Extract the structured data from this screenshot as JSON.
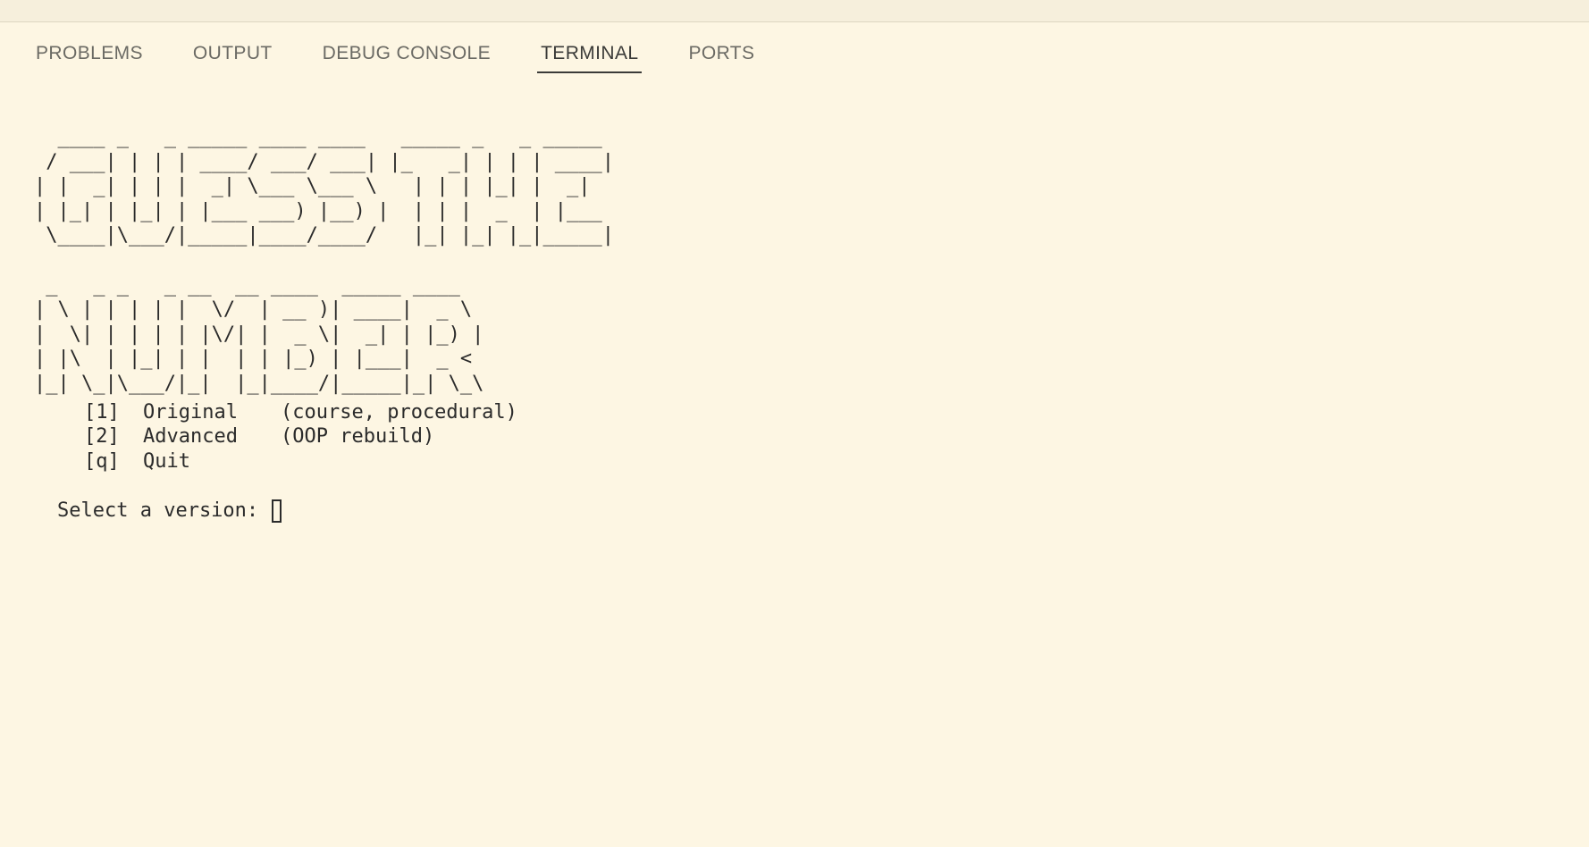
{
  "panel": {
    "tabs": [
      {
        "label": "PROBLEMS",
        "active": false
      },
      {
        "label": "OUTPUT",
        "active": false
      },
      {
        "label": "DEBUG CONSOLE",
        "active": false
      },
      {
        "label": "TERMINAL",
        "active": true
      },
      {
        "label": "PORTS",
        "active": false
      }
    ]
  },
  "terminal": {
    "banner": [
      "  ____ _   _ _____ ____ ____   _____ _   _ _____",
      " / ___| | | | ____/ ___/ ___| |_   _| | | | ____|",
      "| |  _| | | |  _| \\___ \\___ \\   | | | |_| |  _|",
      "| |_| | |_| | |___ ___) |__) |  | | |  _  | |___",
      " \\____|\\___/|_____|____/____/   |_| |_| |_|_____|",
      "",
      " _   _ _   _ __  __ ____  _____ ____",
      "| \\ | | | | |  \\/  | __ )| ____|  _ \\",
      "|  \\| | | | | |\\/| |  _ \\|  _| | |_) |",
      "| |\\  | |_| | |  | | |_) | |___|  _ <",
      "|_| \\_|\\___/|_|  |_|____/|_____|_| \\_\\"
    ],
    "menu": [
      {
        "key": "[1]",
        "name": "Original",
        "desc": "(course, procedural)"
      },
      {
        "key": "[2]",
        "name": "Advanced",
        "desc": "(OOP rebuild)"
      },
      {
        "key": "[q]",
        "name": "Quit",
        "desc": ""
      }
    ],
    "prompt": "Select a version: "
  },
  "colors": {
    "background": "#fdf6e3",
    "text": "#2b2b2b",
    "tab_inactive": "#6b6a64",
    "tab_active": "#3b3b38"
  }
}
